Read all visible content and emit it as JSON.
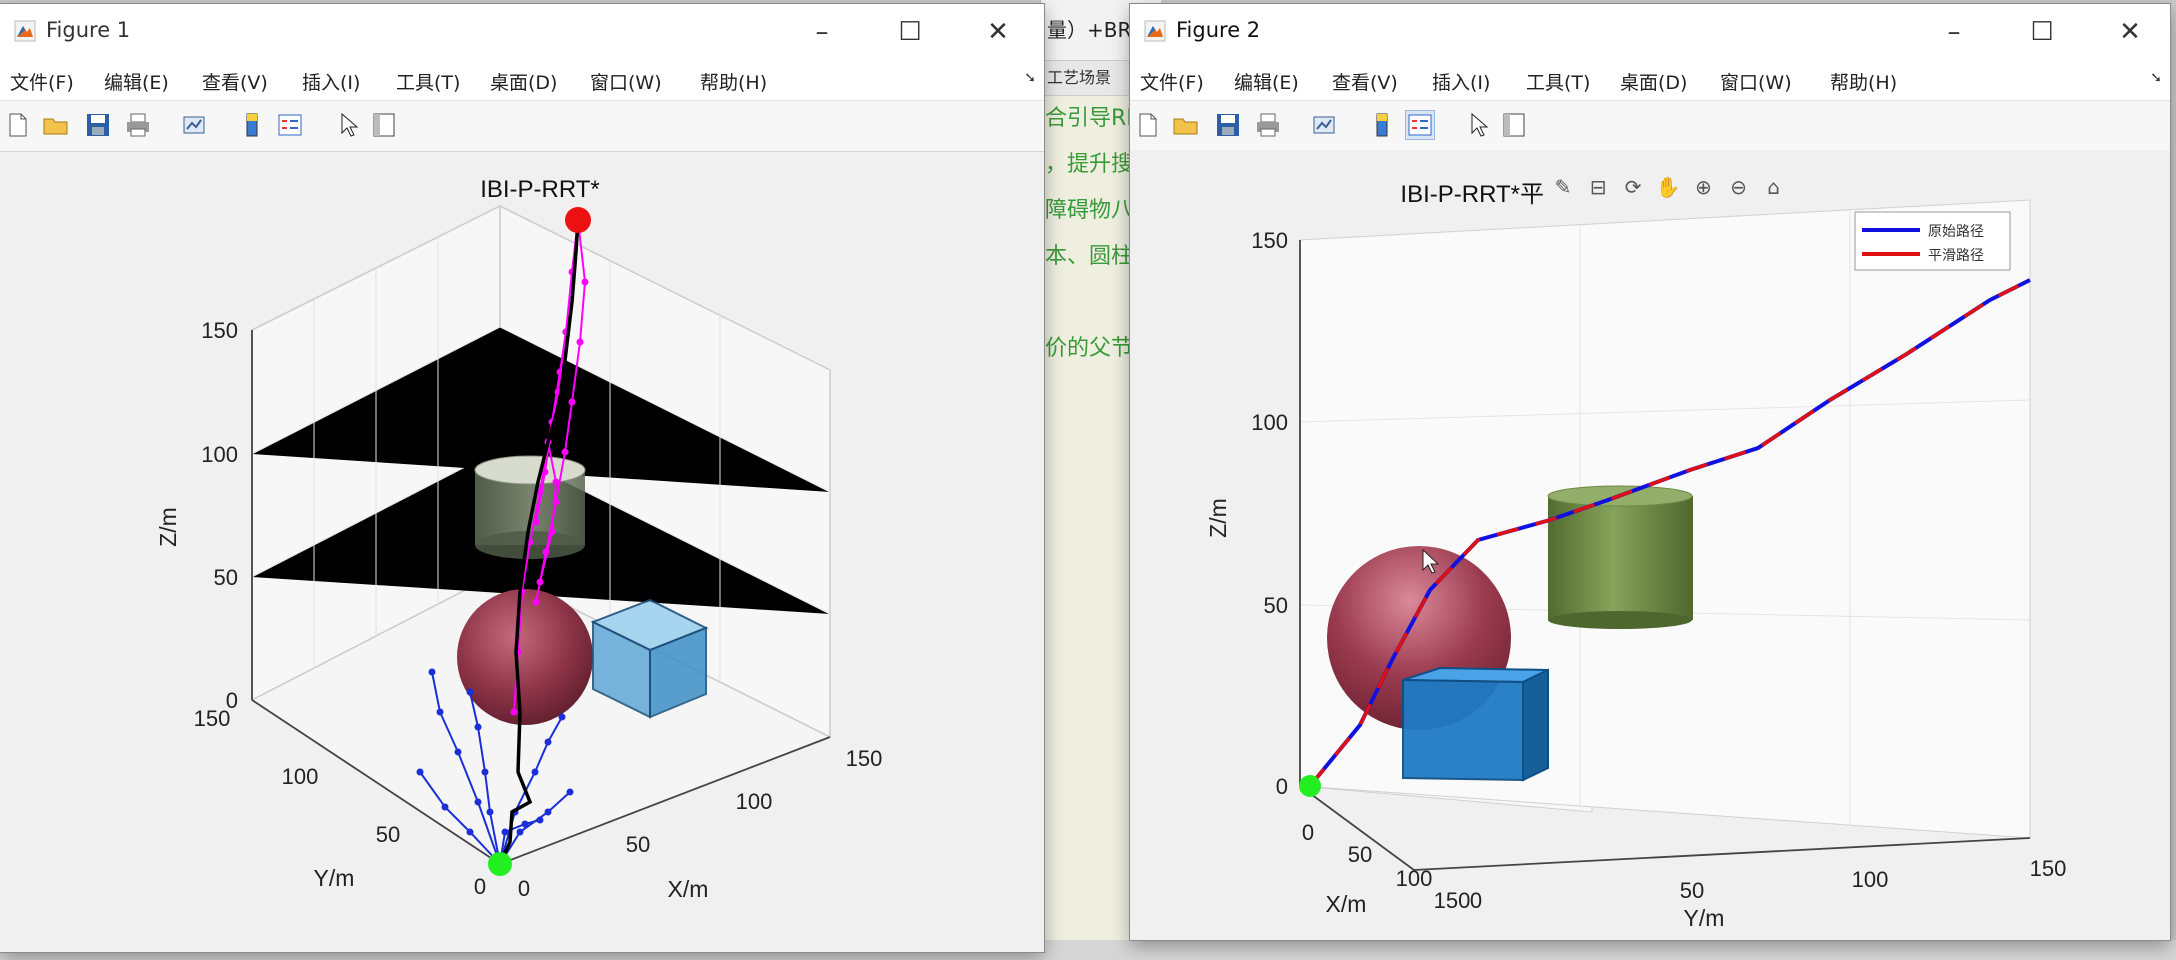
{
  "background_editor": {
    "top_text": "量）+BR",
    "tab_text": "工艺场景",
    "lines": [
      "合引导RR",
      "，提升搜",
      "障碍物八",
      "本、圆柱",
      "",
      "价的父节"
    ]
  },
  "menus": [
    "文件(F)",
    "编辑(E)",
    "查看(V)",
    "插入(I)",
    "工具(T)",
    "桌面(D)",
    "窗口(W)",
    "帮助(H)"
  ],
  "figure1": {
    "window_title": "Figure 1",
    "plot_title": "IBI-P-RRT*",
    "z_ticks": [
      "0",
      "50",
      "100",
      "150"
    ],
    "y_ticks": [
      "0",
      "50",
      "100",
      "150"
    ],
    "x_ticks": [
      "0",
      "50",
      "100",
      "150"
    ],
    "xlabel": "X/m",
    "ylabel": "Y/m",
    "zlabel": "Z/m"
  },
  "figure2": {
    "window_title": "Figure 2",
    "plot_title": "IBI-P-RRT*平",
    "z_ticks": [
      "0",
      "50",
      "100",
      "150"
    ],
    "x_ticks": [
      "0",
      "50",
      "100",
      "150"
    ],
    "y_ticks": [
      "0",
      "50",
      "100",
      "150"
    ],
    "xlabel": "X/m",
    "ylabel": "Y/m",
    "zlabel": "Z/m",
    "legend": [
      {
        "label": "原始路径",
        "color": "#1010e0"
      },
      {
        "label": "平滑路径",
        "color": "#e01010"
      }
    ]
  },
  "colors": {
    "start_marker": "#22ee22",
    "goal_marker": "#ee1111",
    "tree_start": "#1a2fd8",
    "tree_goal": "#ff00ff",
    "final_path": "#000000",
    "sphere": "#9b3a4e",
    "cube": "#1f77c4",
    "cylinder": "#6b8a3e"
  },
  "icons": [
    "matlab-app-icon",
    "minimize-icon",
    "maximize-icon",
    "close-icon",
    "new-file-icon",
    "open-folder-icon",
    "save-icon",
    "print-icon",
    "link-plot-icon",
    "colorbar-icon",
    "legend-icon",
    "pointer-icon",
    "property-inspector-icon",
    "brush-icon",
    "data-tip-icon",
    "rotate-icon",
    "pan-icon",
    "zoom-in-icon",
    "zoom-out-icon",
    "home-icon"
  ]
}
